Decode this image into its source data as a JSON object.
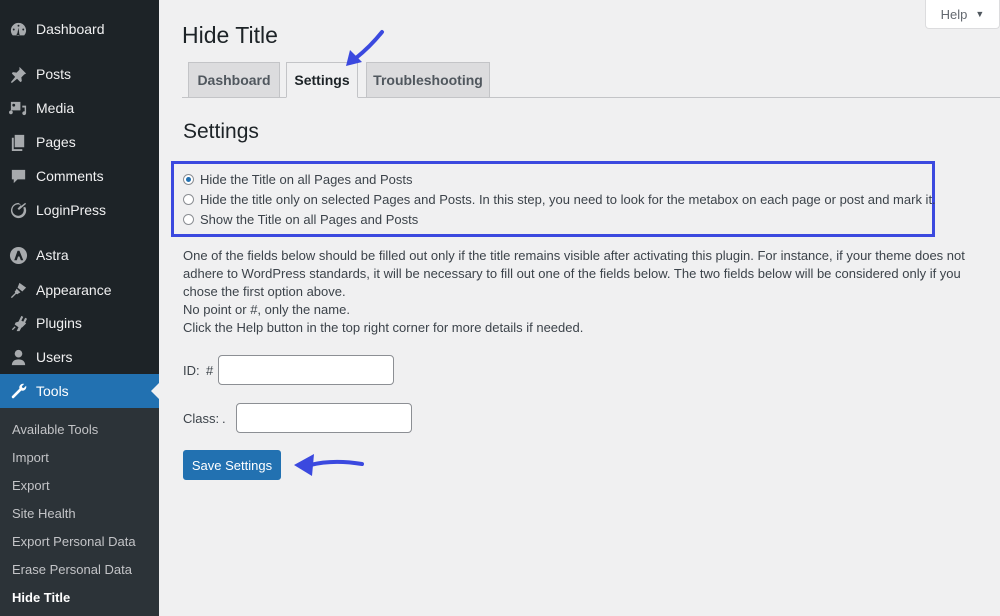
{
  "sidebar": {
    "items": [
      {
        "label": "Dashboard",
        "icon": "dashboard-icon"
      },
      {
        "label": "Posts",
        "icon": "pin-icon"
      },
      {
        "label": "Media",
        "icon": "media-icon"
      },
      {
        "label": "Pages",
        "icon": "pages-icon"
      },
      {
        "label": "Comments",
        "icon": "comment-icon"
      },
      {
        "label": "LoginPress",
        "icon": "loginpress-icon"
      },
      {
        "label": "Astra",
        "icon": "astra-icon"
      },
      {
        "label": "Appearance",
        "icon": "paintbrush-icon"
      },
      {
        "label": "Plugins",
        "icon": "plugin-icon"
      },
      {
        "label": "Users",
        "icon": "user-icon"
      },
      {
        "label": "Tools",
        "icon": "wrench-icon",
        "active": true
      }
    ],
    "submenu": [
      {
        "label": "Available Tools"
      },
      {
        "label": "Import"
      },
      {
        "label": "Export"
      },
      {
        "label": "Site Health"
      },
      {
        "label": "Export Personal Data"
      },
      {
        "label": "Erase Personal Data"
      },
      {
        "label": "Hide Title",
        "current": true
      }
    ]
  },
  "help": {
    "label": "Help",
    "caret": "▼"
  },
  "page": {
    "title": "Hide Title",
    "tabs": [
      {
        "label": "Dashboard"
      },
      {
        "label": "Settings",
        "active": true
      },
      {
        "label": "Troubleshooting"
      }
    ],
    "heading": "Settings",
    "options": [
      {
        "label": "Hide the Title on all Pages and Posts",
        "checked": true
      },
      {
        "label": "Hide the title only on selected Pages and Posts. In this step, you need to look for the metabox on each page or post and mark it.",
        "checked": false
      },
      {
        "label": "Show the Title on all Pages and Posts",
        "checked": false
      }
    ],
    "description": [
      "One of the fields below should be filled out only if the title remains visible after activating this plugin. For instance, if your theme does not adhere to WordPress standards, it will be necessary to fill out one of the fields below. The two fields below will be considered only if you chose the first option above.",
      "No point or #, only the name.",
      "Click the Help button in the top right corner for more details if needed."
    ],
    "id_field": {
      "label": "ID:",
      "prefix": "#",
      "value": ""
    },
    "class_field": {
      "label": "Class:",
      "prefix": ".",
      "value": ""
    },
    "save_label": "Save Settings"
  },
  "colors": {
    "sidebar_bg": "#1d2327",
    "submenu_bg": "#2c3338",
    "accent": "#2271b1",
    "annotation": "#3b49df"
  }
}
